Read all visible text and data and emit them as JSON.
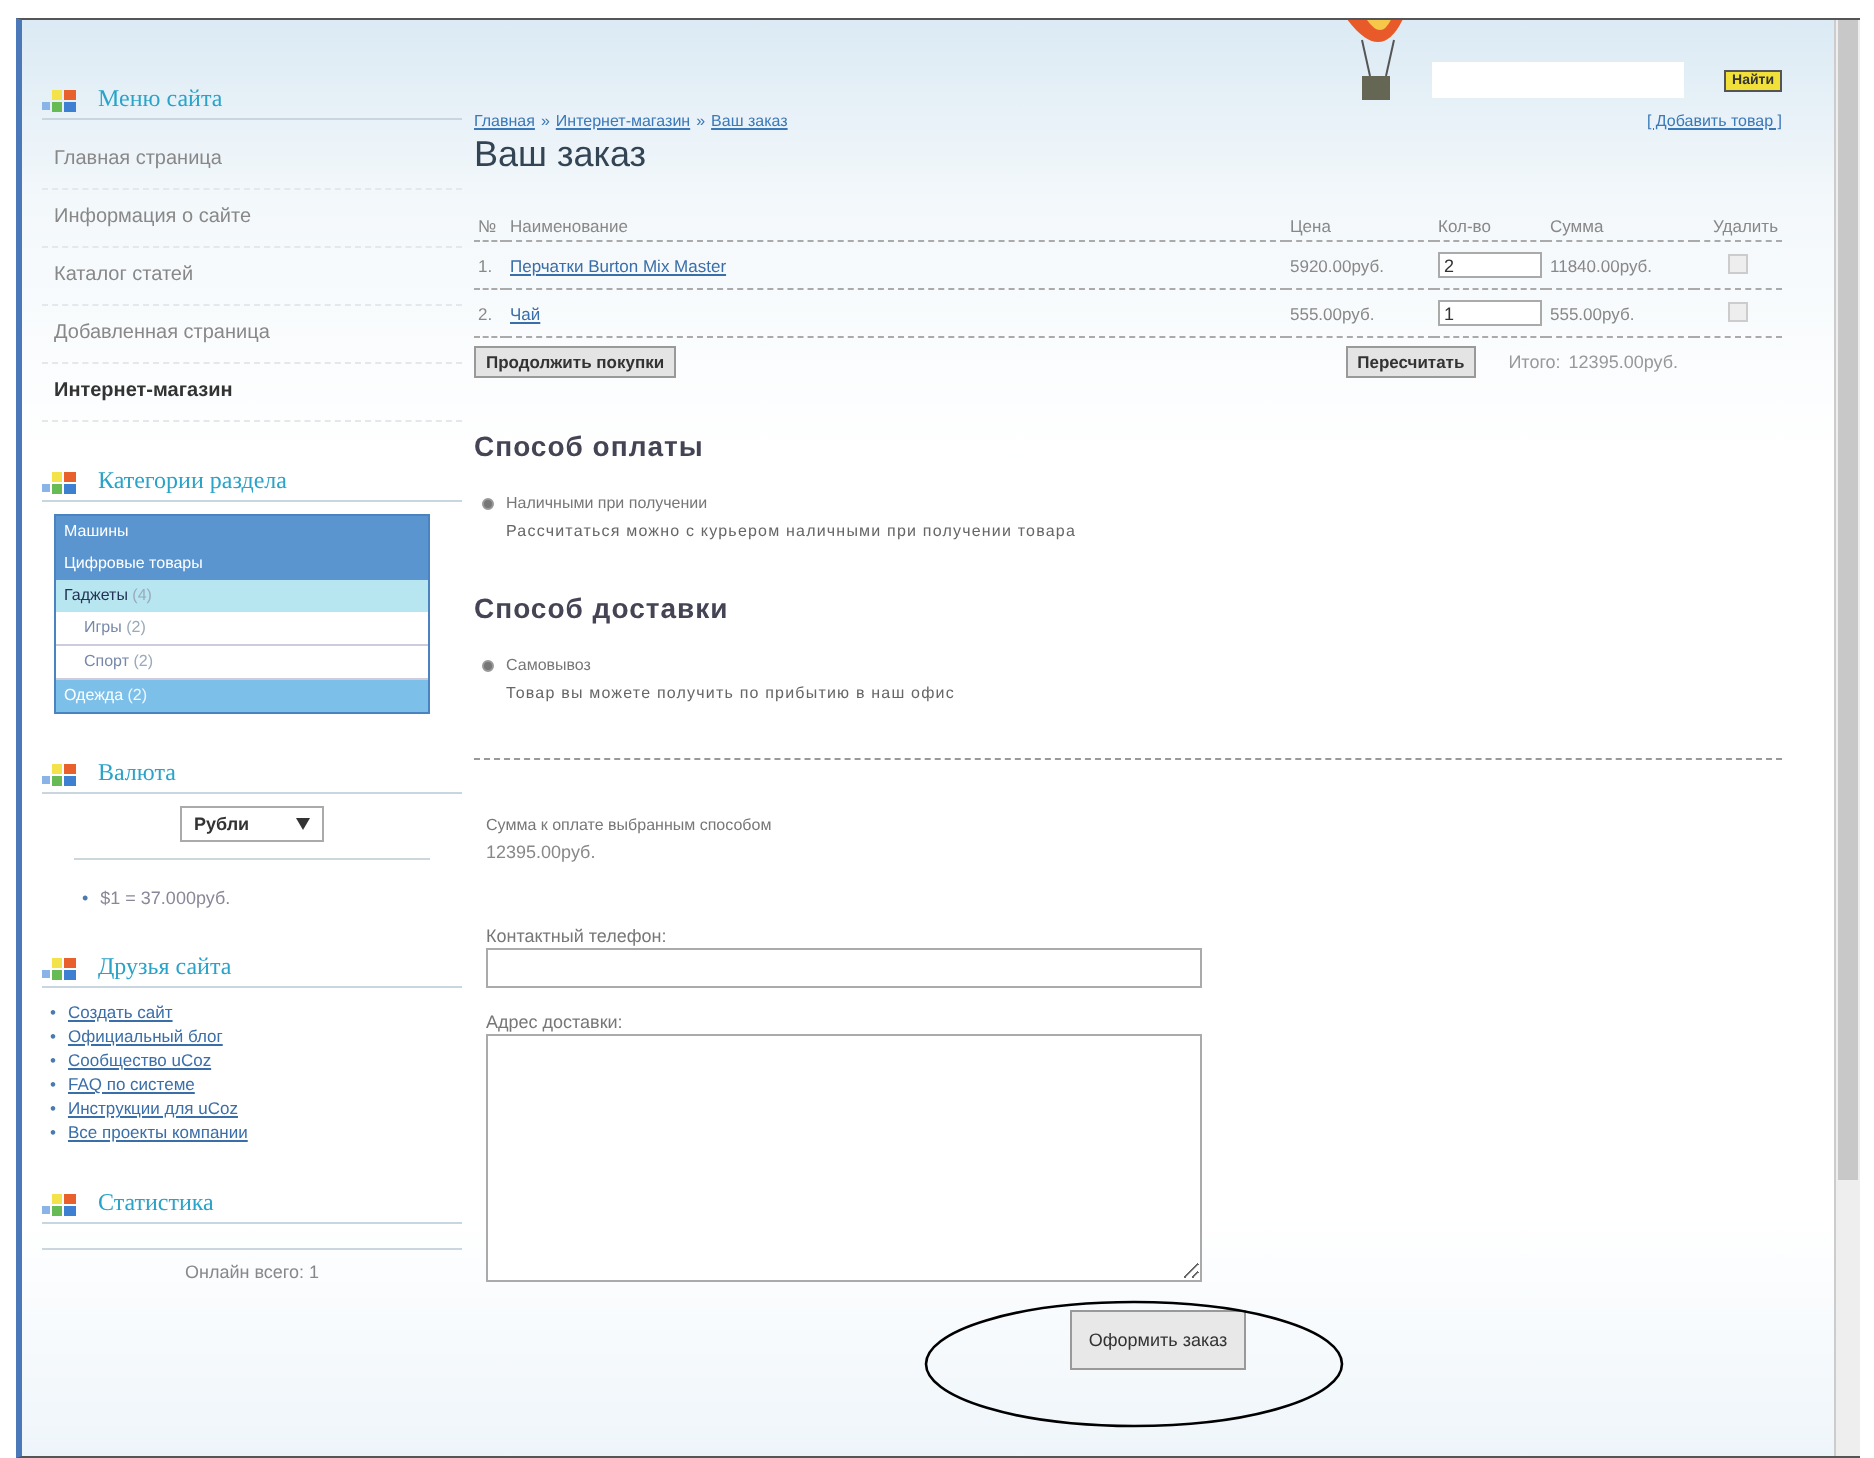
{
  "search": {
    "button": "Найти"
  },
  "sidebar": {
    "menu": {
      "title": "Меню сайта",
      "items": [
        {
          "label": "Главная страница",
          "selected": false
        },
        {
          "label": "Информация о сайте",
          "selected": false
        },
        {
          "label": "Каталог статей",
          "selected": false
        },
        {
          "label": "Добавленная страница",
          "selected": false
        },
        {
          "label": "Интернет-магазин",
          "selected": true
        }
      ]
    },
    "categories": {
      "title": "Категории раздела",
      "items": [
        {
          "label": "Машины",
          "selected": false
        },
        {
          "label": "Цифровые товары",
          "selected": false
        },
        {
          "label": "Гаджеты",
          "count": "(4)",
          "selected": true,
          "children": [
            {
              "label": "Игры",
              "count": "(2)",
              "selected": false
            },
            {
              "label": "Спорт",
              "count": "(2)",
              "selected": false
            }
          ]
        },
        {
          "label": "Одежда",
          "count": "(2)",
          "selected": false
        }
      ]
    },
    "currency": {
      "title": "Валюта",
      "select": "Рубли",
      "bullet": "•",
      "rate": "$1 = 37.000руб."
    },
    "friends": {
      "title": "Друзья сайта",
      "bullet": "•",
      "links": [
        "Создать сайт",
        "Официальный блог",
        "Сообщество uCoz",
        "FAQ по системе",
        "Инструкции для uCoz",
        "Все проекты компании"
      ]
    },
    "stats": {
      "title": "Статистика",
      "online": "Онлайн всего: 1"
    }
  },
  "main": {
    "breadcrumb": [
      "Главная",
      "Интернет-магазин",
      "Ваш заказ"
    ],
    "breadcrumb_separator": "»",
    "add_link": "[ Добавить товар ]",
    "title": "Ваш заказ",
    "table": {
      "columns": [
        "№",
        "Наименование",
        "Цена",
        "Кол-во",
        "Сумма",
        "Удалить"
      ],
      "rows": [
        {
          "num": "1.",
          "name": "Перчатки Burton Mix Master",
          "price": "5920.00руб.",
          "qty": "2",
          "sum": "11840.00руб.",
          "checked": false
        },
        {
          "num": "2.",
          "name": "Чай",
          "price": "555.00руб.",
          "qty": "1",
          "sum": "555.00руб.",
          "checked": false
        }
      ]
    },
    "continue_button": "Продолжить покупки",
    "recalc_button": "Пересчитать",
    "total_label": "Итого:",
    "total": "12395.00руб.",
    "payment": {
      "title": "Способ оплаты",
      "options": [
        {
          "label": "Наличными при получении",
          "description": "Рассчитаться можно с курьером наличными при получении товара",
          "selected": true
        }
      ]
    },
    "delivery": {
      "title": "Способ доставки",
      "options": [
        {
          "label": "Самовывоз",
          "description": "Товар вы можете получить по прибытию в наш офис",
          "selected": true
        }
      ]
    },
    "summary_label": "Сумма к оплате выбранным способом",
    "summary_value": "12395.00руб.",
    "phone_label": "Контактный телефон:",
    "address_label": "Адрес доставки:",
    "submit_button": "Оформить заказ"
  }
}
